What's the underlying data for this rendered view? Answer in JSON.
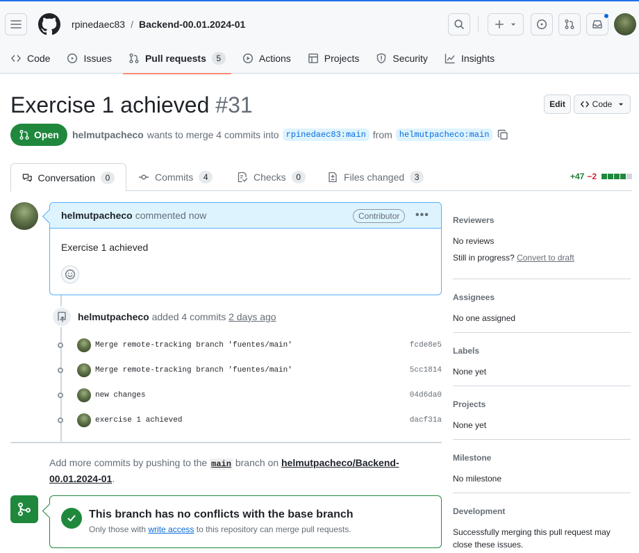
{
  "header": {
    "owner": "rpinedaec83",
    "separator": "/",
    "repo": "Backend-00.01.2024-01"
  },
  "repo_tabs": [
    {
      "label": "Code",
      "icon": "code-icon"
    },
    {
      "label": "Issues",
      "icon": "issue-icon"
    },
    {
      "label": "Pull requests",
      "icon": "pull-request-icon",
      "count": "5"
    },
    {
      "label": "Actions",
      "icon": "play-icon"
    },
    {
      "label": "Projects",
      "icon": "table-icon"
    },
    {
      "label": "Security",
      "icon": "shield-icon"
    },
    {
      "label": "Insights",
      "icon": "graph-icon"
    }
  ],
  "pr": {
    "title": "Exercise 1 achieved",
    "number": "#31",
    "edit_label": "Edit",
    "code_label": "Code",
    "state": "Open",
    "author": "helmutpacheco",
    "meta_text": "wants to merge 4 commits into",
    "base_branch": "rpinedaec83:main",
    "from_text": "from",
    "head_branch": "helmutpacheco:main"
  },
  "pr_tabs": [
    {
      "label": "Conversation",
      "count": "0"
    },
    {
      "label": "Commits",
      "count": "4"
    },
    {
      "label": "Checks",
      "count": "0"
    },
    {
      "label": "Files changed",
      "count": "3"
    }
  ],
  "diffstat": {
    "additions": "+47",
    "deletions": "−2"
  },
  "comment": {
    "author": "helmutpacheco",
    "action": "commented now",
    "role": "Contributor",
    "body": "Exercise 1 achieved"
  },
  "commit_event": {
    "author": "helmutpacheco",
    "action": "added 4 commits",
    "time": "2 days ago"
  },
  "commits": [
    {
      "message": "Merge remote-tracking branch 'fuentes/main'",
      "sha": "fcde8e5"
    },
    {
      "message": "Merge remote-tracking branch 'fuentes/main'",
      "sha": "5cc1814"
    },
    {
      "message": "new changes",
      "sha": "04d6da0"
    },
    {
      "message": "exercise 1 achieved",
      "sha": "dacf31a"
    }
  ],
  "push_note": {
    "prefix": "Add more commits by pushing to the",
    "branch": "main",
    "middle": "branch on",
    "repo": "helmutpacheco/Backend-00.01.2024-01",
    "suffix": "."
  },
  "merge": {
    "title": "This branch has no conflicts with the base branch",
    "sub_prefix": "Only those with",
    "sub_link": "write access",
    "sub_suffix": "to this repository can merge pull requests."
  },
  "sidebar": {
    "reviewers": {
      "heading": "Reviewers",
      "value": "No reviews",
      "progress_prefix": "Still in progress?",
      "progress_link": "Convert to draft"
    },
    "assignees": {
      "heading": "Assignees",
      "value": "No one assigned"
    },
    "labels": {
      "heading": "Labels",
      "value": "None yet"
    },
    "projects": {
      "heading": "Projects",
      "value": "None yet"
    },
    "milestone": {
      "heading": "Milestone",
      "value": "No milestone"
    },
    "development": {
      "heading": "Development",
      "value": "Successfully merging this pull request may close these issues."
    }
  },
  "colors": {
    "accent": "#0969da",
    "success": "#1f883d",
    "danger": "#d1242f",
    "tab_underline": "#fd8c73"
  }
}
